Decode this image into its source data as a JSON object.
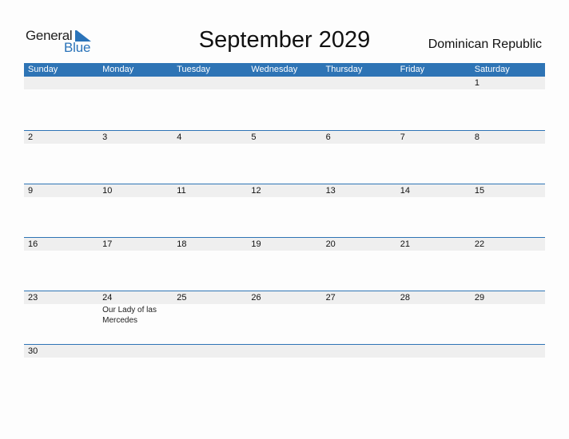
{
  "logo": {
    "word1": "General",
    "word2": "Blue"
  },
  "title": "September 2029",
  "country": "Dominican Republic",
  "colors": {
    "accent": "#2e74b5",
    "date_strip": "#efefef",
    "logo_blue": "#2a73b9"
  },
  "weekdays": [
    "Sunday",
    "Monday",
    "Tuesday",
    "Wednesday",
    "Thursday",
    "Friday",
    "Saturday"
  ],
  "weeks": [
    {
      "days": [
        {
          "num": ""
        },
        {
          "num": ""
        },
        {
          "num": ""
        },
        {
          "num": ""
        },
        {
          "num": ""
        },
        {
          "num": ""
        },
        {
          "num": "1"
        }
      ]
    },
    {
      "days": [
        {
          "num": "2"
        },
        {
          "num": "3"
        },
        {
          "num": "4"
        },
        {
          "num": "5"
        },
        {
          "num": "6"
        },
        {
          "num": "7"
        },
        {
          "num": "8"
        }
      ]
    },
    {
      "days": [
        {
          "num": "9"
        },
        {
          "num": "10"
        },
        {
          "num": "11"
        },
        {
          "num": "12"
        },
        {
          "num": "13"
        },
        {
          "num": "14"
        },
        {
          "num": "15"
        }
      ]
    },
    {
      "days": [
        {
          "num": "16"
        },
        {
          "num": "17"
        },
        {
          "num": "18"
        },
        {
          "num": "19"
        },
        {
          "num": "20"
        },
        {
          "num": "21"
        },
        {
          "num": "22"
        }
      ]
    },
    {
      "days": [
        {
          "num": "23"
        },
        {
          "num": "24",
          "event": "Our Lady of las Mercedes"
        },
        {
          "num": "25"
        },
        {
          "num": "26"
        },
        {
          "num": "27"
        },
        {
          "num": "28"
        },
        {
          "num": "29"
        }
      ]
    },
    {
      "days": [
        {
          "num": "30"
        },
        {
          "num": ""
        },
        {
          "num": ""
        },
        {
          "num": ""
        },
        {
          "num": ""
        },
        {
          "num": ""
        },
        {
          "num": ""
        }
      ]
    }
  ]
}
